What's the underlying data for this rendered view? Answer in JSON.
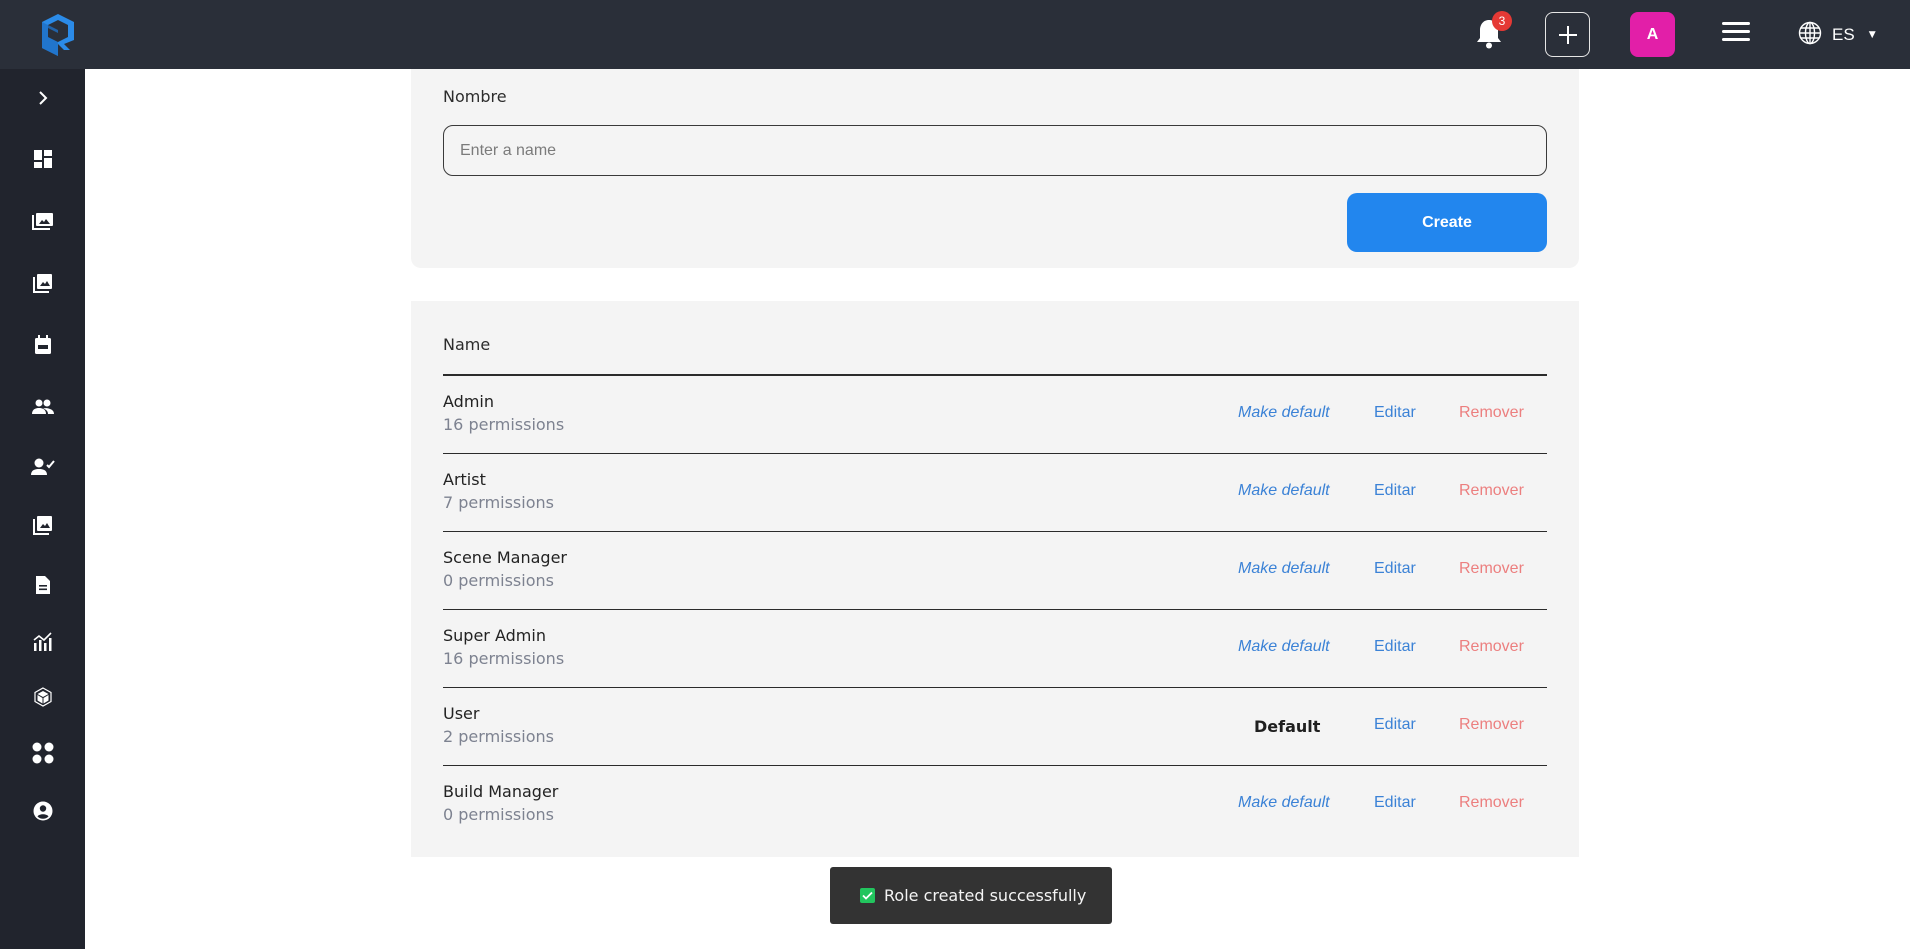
{
  "topbar": {
    "notifications_count": "3",
    "avatar_initial": "A",
    "language": "ES",
    "colors": {
      "bar": "#2a2f39",
      "avatar": "#e21fa8",
      "badge": "#e53935"
    }
  },
  "sidebar": {
    "items": [
      {
        "icon": "chevron-right-icon"
      },
      {
        "icon": "dashboard-icon"
      },
      {
        "icon": "photo-library-icon"
      },
      {
        "icon": "collections-icon"
      },
      {
        "icon": "calendar-event-icon"
      },
      {
        "icon": "people-icon"
      },
      {
        "icon": "person-check-icon"
      },
      {
        "icon": "image-stack-icon"
      },
      {
        "icon": "document-icon"
      },
      {
        "icon": "analytics-icon"
      },
      {
        "icon": "cube-icon"
      },
      {
        "icon": "apps-dots-icon"
      },
      {
        "icon": "account-circle-icon"
      }
    ]
  },
  "create_form": {
    "label": "Nombre",
    "name_value": "",
    "name_placeholder": "Enter a name",
    "create_label": "Create"
  },
  "roles_table": {
    "header": "Name",
    "make_default_label": "Make default",
    "default_label": "Default",
    "edit_label": "Editar",
    "remove_label": "Remover",
    "rows": [
      {
        "name": "Admin",
        "permissions": "16 permissions",
        "is_default": false
      },
      {
        "name": "Artist",
        "permissions": "7 permissions",
        "is_default": false
      },
      {
        "name": "Scene Manager",
        "permissions": "0 permissions",
        "is_default": false
      },
      {
        "name": "Super Admin",
        "permissions": "16 permissions",
        "is_default": false
      },
      {
        "name": "User",
        "permissions": "2 permissions",
        "is_default": true
      },
      {
        "name": "Build Manager",
        "permissions": "0 permissions",
        "is_default": false
      }
    ]
  },
  "toast": {
    "message": "Role created successfully",
    "status": "success",
    "color": "#22c55e"
  }
}
